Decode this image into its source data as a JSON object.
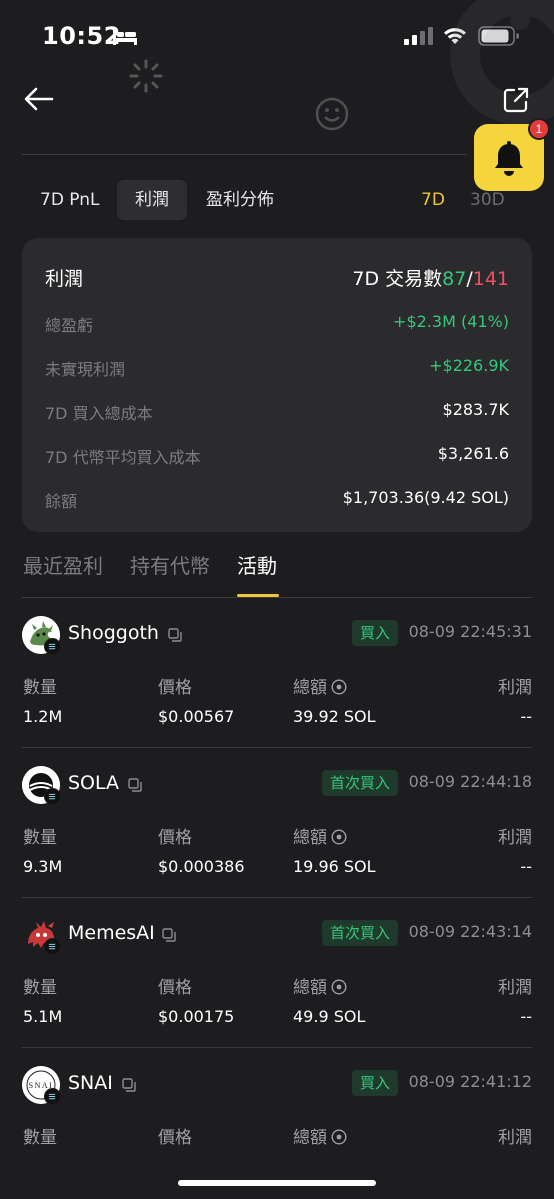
{
  "status_bar": {
    "time": "10:52"
  },
  "filters": {
    "tabs": [
      "7D PnL",
      "利潤",
      "盈利分佈"
    ],
    "active_tab": "利潤",
    "periods": [
      "7D",
      "30D"
    ],
    "active_period": "7D"
  },
  "notification": {
    "badge_count": "1"
  },
  "summary": {
    "title": "利潤",
    "trades_label": "7D 交易數",
    "trades_wins": "87",
    "trades_sep": "/",
    "trades_total": "141",
    "rows": [
      {
        "label": "總盈虧",
        "value": "+$2.3M (41%)"
      },
      {
        "label": "未實現利潤",
        "value": "+$226.9K"
      },
      {
        "label": "7D 買入總成本",
        "value": "$283.7K"
      },
      {
        "label": "7D 代幣平均買入成本",
        "value": "$3,261.6"
      },
      {
        "label": "餘額",
        "value": "$1,703.36(9.42 SOL)"
      }
    ]
  },
  "section_tabs": [
    "最近盈利",
    "持有代幣",
    "活動"
  ],
  "active_section": "活動",
  "columns": {
    "qty": "數量",
    "price": "價格",
    "total": "總額",
    "profit": "利潤"
  },
  "activities": [
    {
      "name": "Shoggoth",
      "tag": "買入",
      "time": "08-09 22:45:31",
      "qty": "1.2M",
      "price": "$0.00567",
      "total": "39.92 SOL",
      "profit": "--"
    },
    {
      "name": "SOLA",
      "tag": "首次買入",
      "time": "08-09 22:44:18",
      "qty": "9.3M",
      "price": "$0.000386",
      "total": "19.96 SOL",
      "profit": "--"
    },
    {
      "name": "MemesAI",
      "tag": "首次買入",
      "time": "08-09 22:43:14",
      "qty": "5.1M",
      "price": "$0.00175",
      "total": "49.9 SOL",
      "profit": "--"
    },
    {
      "name": "SNAI",
      "tag": "買入",
      "time": "08-09 22:41:12",
      "qty": "",
      "price": "",
      "total": "",
      "profit": ""
    }
  ],
  "colors": {
    "accent": "#f0c53a",
    "positive": "#35c77b",
    "negative": "#f05260",
    "background": "#1d1d1f",
    "card": "#2b2b2d"
  }
}
